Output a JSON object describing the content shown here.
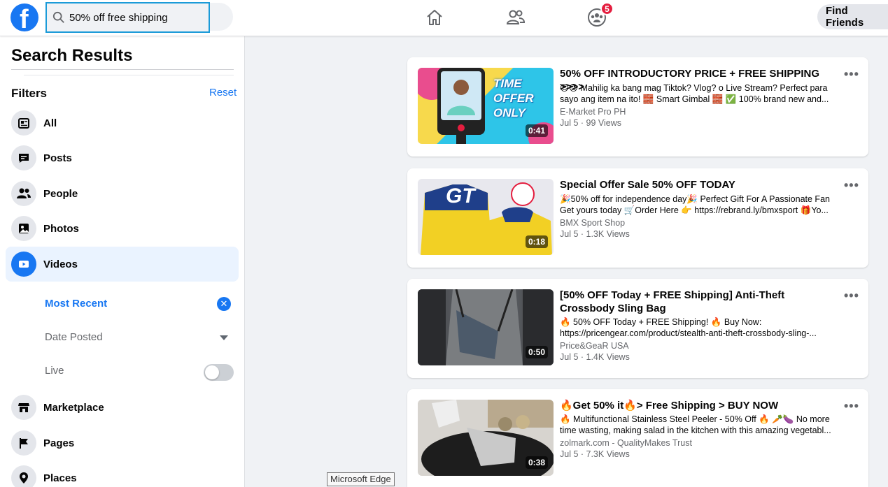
{
  "header": {
    "logo_letter": "f",
    "search_query": "50% off free shipping",
    "notifications_badge": "5",
    "find_friends_label": "Find Friends",
    "nav_icons": [
      "home-icon",
      "friends-icon",
      "groups-icon"
    ]
  },
  "sidebar": {
    "title": "Search Results",
    "filters_label": "Filters",
    "reset_label": "Reset",
    "items": [
      {
        "label": "All",
        "icon": "feed-icon"
      },
      {
        "label": "Posts",
        "icon": "posts-icon"
      },
      {
        "label": "People",
        "icon": "people-icon"
      },
      {
        "label": "Photos",
        "icon": "photos-icon"
      },
      {
        "label": "Videos",
        "icon": "video-icon",
        "active": true
      },
      {
        "label": "Marketplace",
        "icon": "marketplace-icon"
      },
      {
        "label": "Pages",
        "icon": "flag-icon"
      },
      {
        "label": "Places",
        "icon": "location-pin-icon"
      }
    ],
    "video_filters": {
      "most_recent": "Most Recent",
      "date_posted": "Date Posted",
      "live": "Live",
      "live_on": false
    }
  },
  "results": [
    {
      "title": "50% OFF INTRODUCTORY PRICE + FREE SHIPPING >>>>",
      "desc_line1": "😍😍 Mahilig ka bang mag Tiktok? Vlog? o Live Stream? Perfect para",
      "desc_line2": "sayo ang item na ito! 🧱 Smart Gimbal 🧱 ✅ 100% brand new and...",
      "source": "E-Market Pro PH",
      "meta": "Jul 5 · 99 Views",
      "duration": "0:41",
      "thumb_text": "TIME OFFER ONLY"
    },
    {
      "title": "Special Offer Sale 50% OFF TODAY",
      "desc_line1": "🎉50% off for independence day🎉 Perfect Gift For A Passionate Fan",
      "desc_line2": "Get yours today 🛒Order Here 👉 https://rebrand.ly/bmxsport 🎁Yo...",
      "source": "BMX Sport Shop",
      "meta": "Jul 5 · 1.3K Views",
      "duration": "0:18",
      "thumb_text": "GT"
    },
    {
      "title": "[50% OFF Today + FREE Shipping] Anti-Theft Crossbody Sling Bag",
      "desc_line1": "🔥 50% OFF Today + FREE Shipping! 🔥 Buy Now:",
      "desc_line2": "https://pricengear.com/product/stealth-anti-theft-crossbody-sling-...",
      "source": "Price&GeaR USA",
      "meta": "Jul 5 · 1.4K Views",
      "duration": "0:50",
      "thumb_text": ""
    },
    {
      "title": "🔥Get 50% it🔥> Free Shipping > BUY NOW",
      "desc_line1": "🔥 Multifunctional Stainless Steel Peeler - 50% Off 🔥 🥕🍆 No more",
      "desc_line2": "time wasting, making salad in the kitchen with this amazing vegetabl...",
      "source": "zolmark.com - QualityMakes Trust",
      "meta": "Jul 5 · 7.3K Views",
      "duration": "0:38",
      "thumb_text": ""
    }
  ],
  "tooltip": "Microsoft Edge",
  "colors": {
    "brand": "#1877f2",
    "badge": "#e41e3f",
    "search_focus": "#1b9bd8"
  }
}
